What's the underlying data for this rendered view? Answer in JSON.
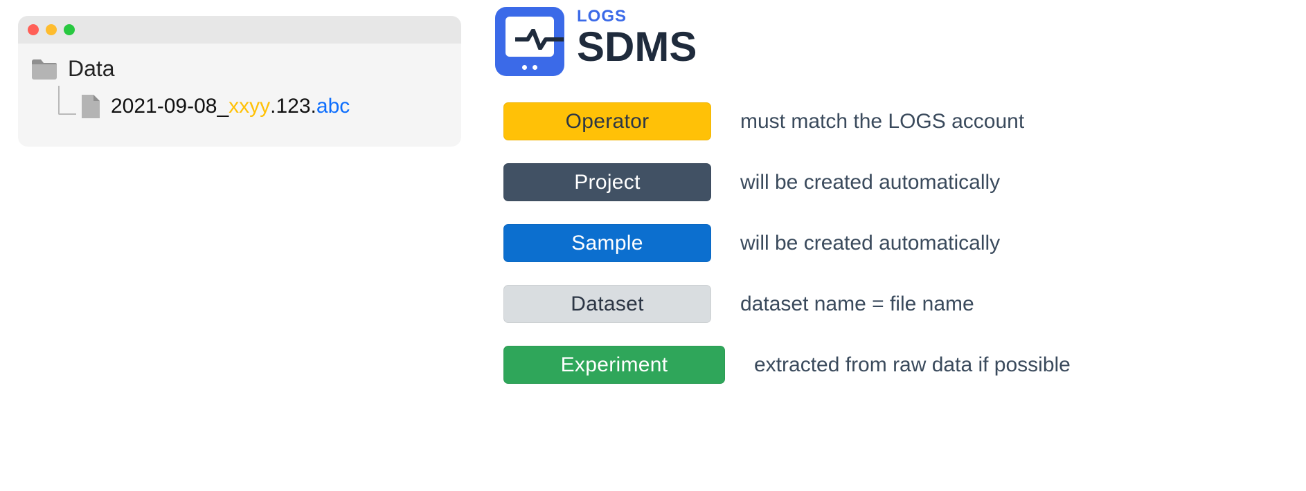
{
  "folder_name": "Data",
  "file": {
    "black_prefix": "2021-09-08_",
    "orange": "xxyy",
    "mid_black": ".123.",
    "ext": "abc"
  },
  "logo": {
    "top": "LOGS",
    "main": "SDMS"
  },
  "rows": [
    {
      "key": "operator",
      "label": "Operator",
      "desc": "must match the LOGS account",
      "cls": "pill-operator",
      "wide": false
    },
    {
      "key": "project",
      "label": "Project",
      "desc": "will be created automatically",
      "cls": "pill-project",
      "wide": false
    },
    {
      "key": "sample",
      "label": "Sample",
      "desc": "will be created automatically",
      "cls": "pill-sample",
      "wide": false
    },
    {
      "key": "dataset",
      "label": "Dataset",
      "desc": "dataset name = file name",
      "cls": "pill-dataset",
      "wide": false
    },
    {
      "key": "experiment",
      "label": "Experiment",
      "desc": "extracted from raw data if possible",
      "cls": "pill-experiment",
      "wide": true
    }
  ]
}
